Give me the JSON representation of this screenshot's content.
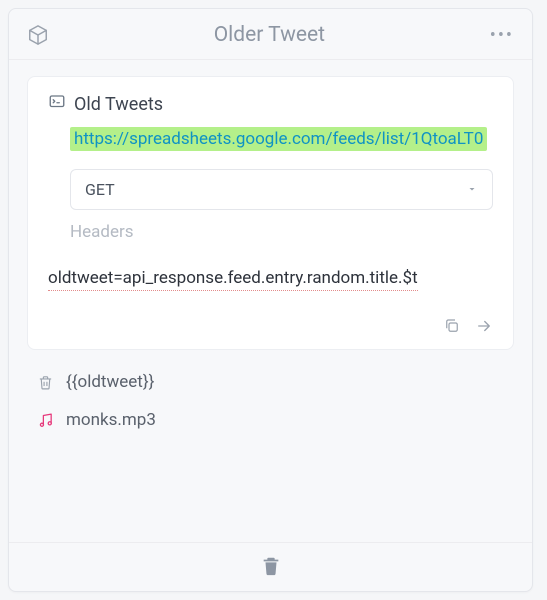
{
  "header": {
    "title": "Older Tweet"
  },
  "card": {
    "title": "Old Tweets",
    "url": "https://spreadsheets.google.com/feeds/list/1QtoaLT0",
    "method": "GET",
    "headers_placeholder": "Headers",
    "expression": "oldtweet=api_response.feed.entry.random.title.$t"
  },
  "items": {
    "variable": "{{oldtweet}}",
    "audio": "monks.mp3"
  }
}
